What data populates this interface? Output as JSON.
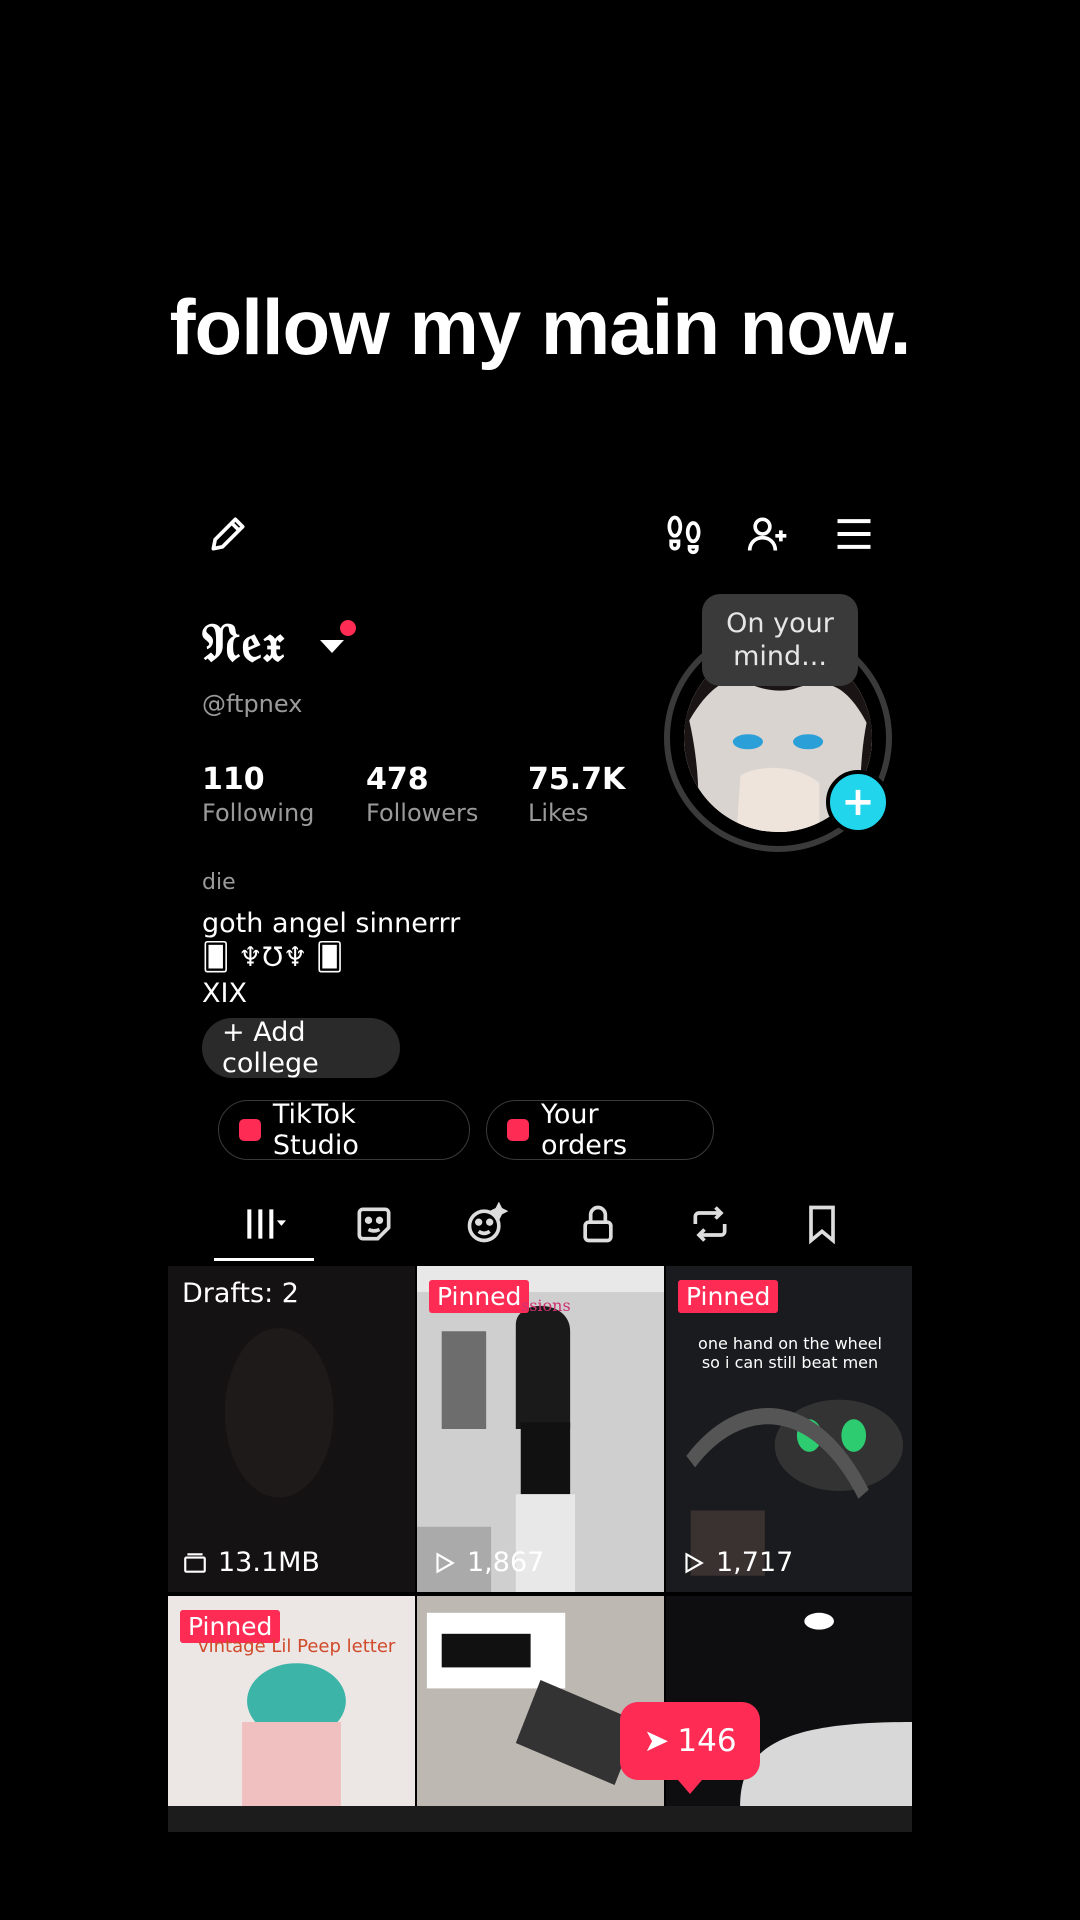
{
  "caption": "follow my main now.",
  "profile": {
    "name": "𝔑𝔢𝔵",
    "handle": "@ftpnex",
    "bubble": "On your mind...",
    "stats": [
      {
        "num": "110",
        "label": "Following"
      },
      {
        "num": "478",
        "label": "Followers"
      },
      {
        "num": "75.7K",
        "label": "Likes"
      }
    ],
    "bio_small": "die",
    "bio_lines": [
      "goth angel sinnerrr",
      "🂠 ♆Ʊ♆ 🂠",
      "XIX"
    ],
    "add_college": "+ Add college",
    "studio": "TikTok Studio",
    "orders": "Your orders"
  },
  "grid": {
    "drafts": "Drafts: 2",
    "drafts_size": "13.1MB",
    "pinned": "Pinned",
    "cell2_views": "1,867",
    "cell3_views": "1,717",
    "cell3_caption": "one hand on the wheel so i can still beat men",
    "cell2_caption": "ssions",
    "cell4_caption": "vintage Lil Peep letter"
  },
  "notification": {
    "count": "146"
  },
  "colors": {
    "accent": "#fe2c55",
    "teal": "#20d5ec",
    "bg": "#000000"
  }
}
